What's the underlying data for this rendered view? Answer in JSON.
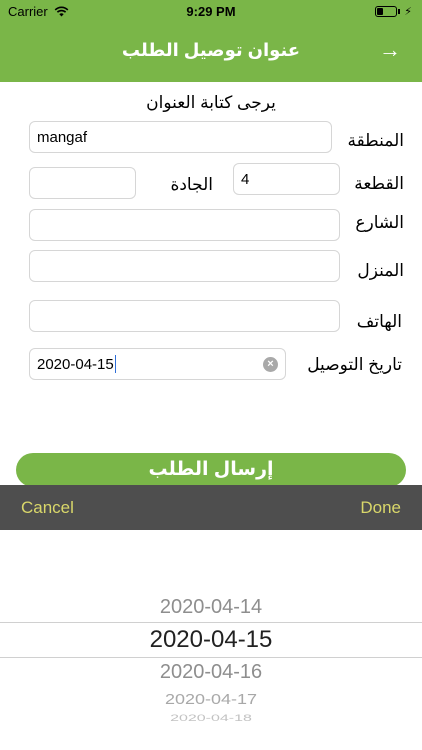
{
  "status_bar": {
    "carrier": "Carrier",
    "time": "9:29 PM"
  },
  "navbar": {
    "title": "عنوان توصيل الطلب",
    "back_arrow": "→"
  },
  "form": {
    "instruction": "يرجى كتابة العنوان",
    "area": {
      "label": "المنطقة",
      "value": "mangaf"
    },
    "block": {
      "label": "القطعة",
      "value": "4"
    },
    "avenue": {
      "label": "الجادة",
      "value": ""
    },
    "street": {
      "label": "الشارع",
      "value": ""
    },
    "house": {
      "label": "المنزل",
      "value": ""
    },
    "phone": {
      "label": "الهاتف",
      "value": ""
    },
    "delivery_date": {
      "label": "تاريخ التوصيل",
      "value": "2020-04-15"
    },
    "submit_label": "إرسال الطلب"
  },
  "picker_toolbar": {
    "cancel_label": "Cancel",
    "done_label": "Done"
  },
  "date_picker": {
    "options": [
      "2020-04-14",
      "2020-04-15",
      "2020-04-16",
      "2020-04-17",
      "2020-04-18"
    ],
    "selected": "2020-04-15"
  },
  "colors": {
    "brand_green": "#7ab648",
    "toolbar_bg": "#4e4e4e",
    "toolbar_text": "#d9d76a"
  }
}
